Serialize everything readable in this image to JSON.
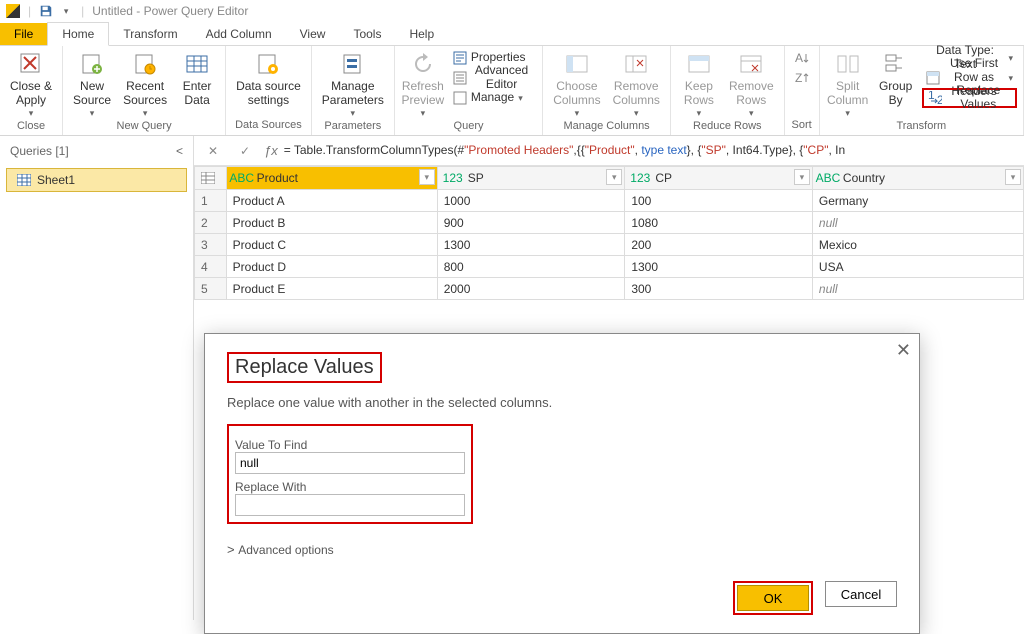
{
  "title": "Untitled - Power Query Editor",
  "tabs": {
    "file": "File",
    "home": "Home",
    "transform": "Transform",
    "addcol": "Add Column",
    "view": "View",
    "tools": "Tools",
    "help": "Help"
  },
  "ribbon": {
    "close_apply": "Close &\nApply",
    "new_source": "New\nSource",
    "recent_sources": "Recent\nSources",
    "enter_data": "Enter\nData",
    "data_source": "Data source\nsettings",
    "manage_params": "Manage\nParameters",
    "refresh": "Refresh\nPreview",
    "properties": "Properties",
    "adv_editor": "Advanced Editor",
    "manage": "Manage",
    "choose_cols": "Choose\nColumns",
    "remove_cols": "Remove\nColumns",
    "keep_rows": "Keep\nRows",
    "remove_rows": "Remove\nRows",
    "split": "Split\nColumn",
    "groupby": "Group\nBy",
    "datatype": "Data Type: Text",
    "firstrow": "Use First Row as Headers",
    "replace": "Replace Values",
    "g_close": "Close",
    "g_newquery": "New Query",
    "g_datasources": "Data Sources",
    "g_params": "Parameters",
    "g_query": "Query",
    "g_managecols": "Manage Columns",
    "g_reducerows": "Reduce Rows",
    "g_sort": "Sort",
    "g_transform": "Transform"
  },
  "queries": {
    "header": "Queries [1]",
    "items": [
      "Sheet1"
    ]
  },
  "formula": {
    "prefix": "= Table.TransformColumnTypes(#",
    "a": "\"Promoted Headers\"",
    "b": ",{{",
    "c": "\"Product\"",
    "d": ", ",
    "e": "type text",
    "f": "}, {",
    "g": "\"SP\"",
    "h": ", Int64.Type}, {",
    "i": "\"CP\"",
    "j": ", In"
  },
  "cols": {
    "product": "Product",
    "sp": "SP",
    "cp": "CP",
    "country": "Country"
  },
  "rows": [
    {
      "n": "1",
      "p": "Product A",
      "sp": "1000",
      "cp": "100",
      "c": "Germany"
    },
    {
      "n": "2",
      "p": "Product B",
      "sp": "900",
      "cp": "1080",
      "c": "null",
      "null": true
    },
    {
      "n": "3",
      "p": "Product C",
      "sp": "1300",
      "cp": "200",
      "c": "Mexico"
    },
    {
      "n": "4",
      "p": "Product D",
      "sp": "800",
      "cp": "1300",
      "c": "USA"
    },
    {
      "n": "5",
      "p": "Product E",
      "sp": "2000",
      "cp": "300",
      "c": "null",
      "null": true
    }
  ],
  "dialog": {
    "title": "Replace Values",
    "desc": "Replace one value with another in the selected columns.",
    "find_lbl": "Value To Find",
    "find_val": "null",
    "repl_lbl": "Replace With",
    "repl_val": "",
    "adv": "Advanced options",
    "ok": "OK",
    "cancel": "Cancel"
  }
}
